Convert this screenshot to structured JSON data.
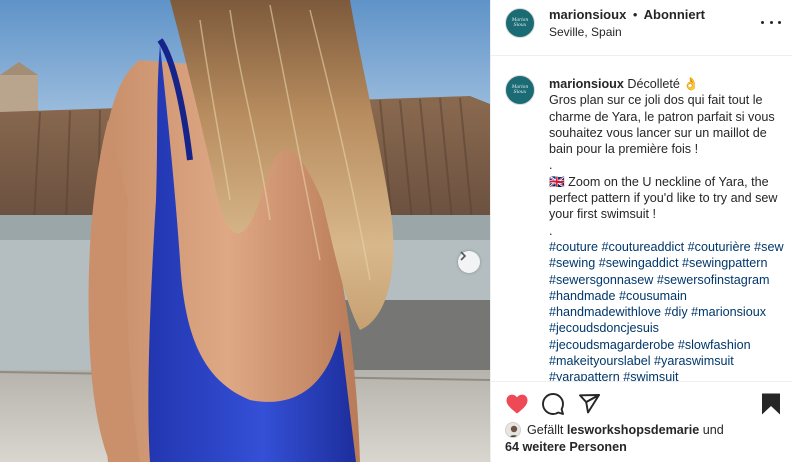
{
  "post": {
    "username": "marionsioux",
    "separator": "•",
    "follow_status": "Abonniert",
    "location": "Seville, Spain",
    "avatar_text": "Marion Sioux",
    "icons": {
      "next": "chevron-right-icon",
      "more": "more-options-icon",
      "like": "heart-filled-icon",
      "comment": "comment-icon",
      "share": "share-icon",
      "save": "bookmark-filled-icon"
    },
    "colors": {
      "like_red": "#ed4956",
      "hashtag": "#00376b",
      "avatar_teal": "#1b6b74",
      "swimsuit_blue": "#2a3fc6"
    }
  },
  "caption": {
    "username": "marionsioux",
    "lines": [
      "Décolleté 👌",
      "Gros plan sur ce joli dos qui fait tout le charme de Yara, le patron parfait si vous souhaitez vous lancer sur un maillot de bain pour la première fois !",
      ".",
      "🇬🇧 Zoom on the U neckline of Yara, the perfect pattern if you'd like to try and sew your first swimsuit !",
      "."
    ],
    "hashtags": [
      "#couture",
      "#coutureaddict",
      "#couturière",
      "#sew",
      "#sewing",
      "#sewingaddict",
      "#sewingpattern",
      "#sewersgonnasew",
      "#sewersofinstagram",
      "#handmade",
      "#cousumain",
      "#handmadewithlove",
      "#diy",
      "#marionsioux",
      "#jecoudsdoncjesuis",
      "#jecoudsmagarderobe",
      "#slowfashion",
      "#makeityourslabel",
      "#yaraswimsuit",
      "#yarapattern",
      "#swimsuit"
    ]
  },
  "likes": {
    "prefix": "Gefällt",
    "liker": "lesworkshopsdemarie",
    "conjunction": "und",
    "others": "64 weitere Personen"
  }
}
